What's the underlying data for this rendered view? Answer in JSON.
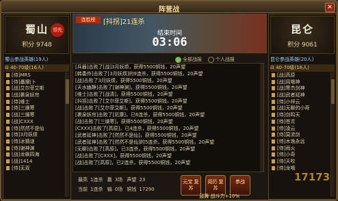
{
  "window": {
    "title": "阵营战",
    "close_label": "✕"
  },
  "left": {
    "clan": "蜀山",
    "seal": "领先",
    "score": "积分 9748",
    "roster_title": "蜀山参战英雄(19人)",
    "group": "40-70级(16人)",
    "members": [
      "[侍]MRS",
      "[侍]聶捜|卜",
      "[战]艾尔菲艾斯",
      "[战]裹泉妖帘",
      "[侍]维士",
      "[侍]三燥寒",
      "[战]三燥寒",
      "[战]CXXX",
      "[侍]然然不是仙",
      "[侍]3月妖烦",
      "[侍]冰猜谜",
      "[侍]谢神渊",
      "[战]龙飙四海",
      "[战]1414",
      "[侍]无双"
    ]
  },
  "right": {
    "clan": "昆仑",
    "score": "积分 9061",
    "roster_title": "昆仑参战英雄(20人)",
    "group": "40-70级(16人)",
    "members": [
      "[战]高原",
      "[战]周哦神",
      "[战]寒杰剑神",
      "[战]武者延神",
      "[侍]小祥云",
      "[战]无聊的小奇",
      "[侍]剑鸣天",
      "[侍]苍朮",
      "[侍]凌云",
      "[侍]莫流剑",
      "[侍]木逸永远",
      "[侍]雨火",
      "[侍]小奇",
      "[侍]天吹",
      "[侍]龙哦"
    ]
  },
  "banner": {
    "streak_badge": "连胜榜",
    "streak_text": "[抖拐]21连杀",
    "end_label": "结束时间",
    "end_time": "03:06"
  },
  "filters": {
    "all": "全部战报",
    "mine": "个人战报"
  },
  "log": [
    "[兵器]击败了[战]3月妖烦，获得5500铜钱，20声望",
    "[韩委炸]击败了[3月妖烦]的9连杀，获得5500铜钱，20声望",
    "[战]击败了3月妖烦，获得5500铜钱，20声望",
    "[天水幽静]击败了[谢神渊]，获得5500铜钱，20声望",
    "[维士]击败了[战清]，获得5500铜钱，20声望",
    "[抖拐]击败了[艾尔菲艾斯]，获得5500铜钱，20声望",
    "[战]击败了[艾尔菲艾斯]，获得5500铜钱，20声望",
    "[裹泉妖帘]击败了[尼康]，已6连杀，获得5500铜钱，20声望",
    "[战]击败了[三燥寒]，获得5500铜钱，20声望",
    "[CXXX]击败了[高原]，已4连杀，获得5500铜钱，20声望",
    "[武者延神]击败了[然然不是仙]，获得5500铜钱，20声望",
    "[武者延神]击败了[然然不是仙]的5连杀，获得5500铜钱，20声望",
    "[无聊]击败了[高原]，已3连杀，获得5500铜钱，20声望",
    "[战]击败了[CXXX]，获得5500铜钱，20声望",
    "[战]击败了[高原]，已2连杀，获得5500铜钱，20声望"
  ],
  "stats": {
    "best_label": "最高",
    "best": "1连杀",
    "win_label": "赢",
    "win": "3场",
    "rep_label": "声望",
    "rep": "23",
    "cur_label": "当前",
    "cur": "1连杀",
    "lose_label": "输",
    "lose": "0场",
    "coin_label": "铜钱",
    "coin": "17290"
  },
  "buttons": {
    "b1": "元宝 复苏",
    "b2": "阅历 复苏",
    "b3": "参战"
  },
  "morale": "鼓舞 战斗力+10%",
  "watermark": "17173"
}
